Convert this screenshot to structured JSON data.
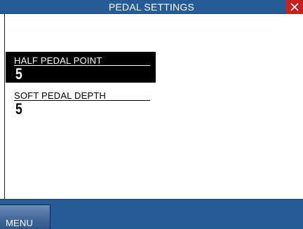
{
  "header": {
    "title": "PEDAL SETTINGS",
    "close_icon": "close-x-icon"
  },
  "settings": [
    {
      "label": "HALF PEDAL POINT",
      "value": "5",
      "selected": true
    },
    {
      "label": "SOFT PEDAL DEPTH",
      "value": "5",
      "selected": false
    }
  ],
  "footer": {
    "menu_label": "MENU"
  },
  "colors": {
    "bar_blue": "#275b95",
    "close_red": "#c81f1f",
    "selection_black": "#000000",
    "background": "#ffffff"
  }
}
